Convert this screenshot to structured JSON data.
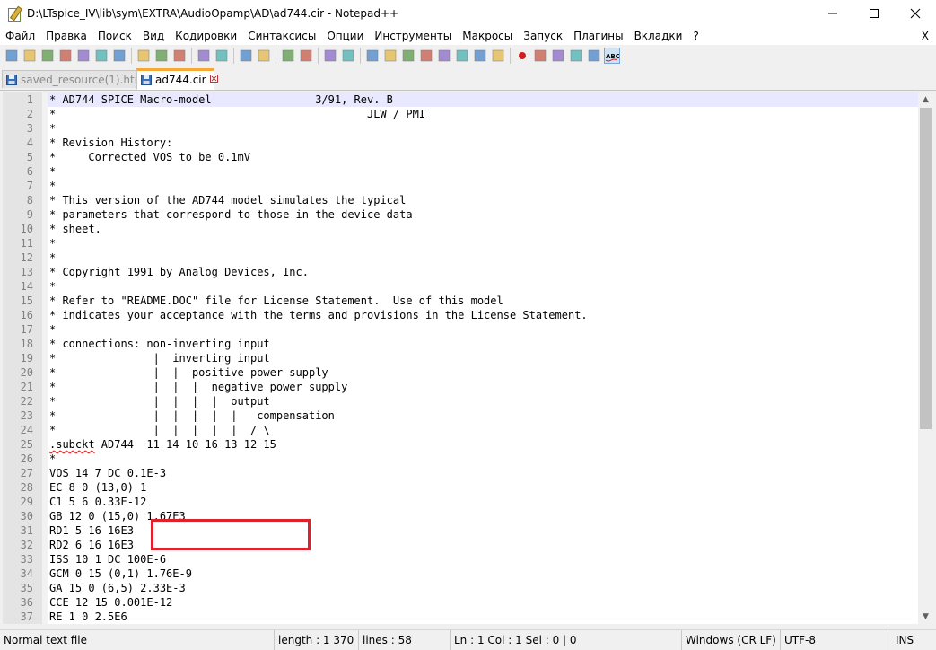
{
  "window": {
    "title": "D:\\LTspice_IV\\lib\\sym\\EXTRA\\AudioOpamp\\AD\\ad744.cir - Notepad++",
    "minimize_glyph": "—",
    "close_glyph": "✕",
    "icon": "notepad-plus-plus-icon"
  },
  "menu": {
    "items": [
      "Файл",
      "Правка",
      "Поиск",
      "Вид",
      "Кодировки",
      "Синтаксисы",
      "Опции",
      "Инструменты",
      "Макросы",
      "Запуск",
      "Плагины",
      "Вкладки",
      "?"
    ],
    "close": "X"
  },
  "toolbar": {
    "buttons": [
      "new-file-icon",
      "open-file-icon",
      "save-icon",
      "save-all-icon",
      "close-icon",
      "close-all-icon",
      "print-icon",
      "cut-icon",
      "copy-icon",
      "paste-icon",
      "undo-icon",
      "redo-icon",
      "find-icon",
      "replace-icon",
      "zoom-in-icon",
      "zoom-out-icon",
      "sync-vertical-icon",
      "sync-horizontal-icon",
      "word-wrap-icon",
      "show-all-chars-icon",
      "indent-guide-icon",
      "user-lang-icon",
      "doc-map-icon",
      "function-list-icon",
      "folder-as-workspace-icon",
      "monitoring-icon",
      "record-macro-icon",
      "stop-macro-icon",
      "play-macro-icon",
      "run-macro-multiple-icon",
      "save-macro-icon",
      "spell-check-icon"
    ],
    "spell_label": "ABC"
  },
  "tabs": [
    {
      "label": "saved_resource(1).html",
      "active": false
    },
    {
      "label": "ad744.cir",
      "active": true
    }
  ],
  "editor": {
    "lines": [
      "* AD744 SPICE Macro-model                3/91, Rev. B",
      "*                                                JLW / PMI",
      "*",
      "* Revision History:",
      "*     Corrected VOS to be 0.1mV",
      "*",
      "*",
      "* This version of the AD744 model simulates the typical",
      "* parameters that correspond to those in the device data",
      "* sheet.",
      "*",
      "*",
      "* Copyright 1991 by Analog Devices, Inc.",
      "*",
      "* Refer to \"README.DOC\" file for License Statement.  Use of this model",
      "* indicates your acceptance with the terms and provisions in the License Statement.",
      "*",
      "* connections: non-inverting input",
      "*               |  inverting input",
      "*               |  |  positive power supply",
      "*               |  |  |  negative power supply",
      "*               |  |  |  |  output",
      "*               |  |  |  |  |   compensation",
      "*               |  |  |  |  |  / \\",
      ".subckt AD744  11 14 10 16 13 12 15",
      "*",
      "VOS 14 7 DC 0.1E-3",
      "EC 8 0 (13,0) 1",
      "C1 5 6 0.33E-12",
      "GB 12 0 (15,0) 1.67E3",
      "RD1 5 16 16E3",
      "RD2 6 16 16E3",
      "ISS 10 1 DC 100E-6",
      "GCM 0 15 (0,1) 1.76E-9",
      "GA 15 0 (6,5) 2.33E-3",
      "CCE 12 15 0.001E-12",
      "RE 1 0 2.5E6"
    ]
  },
  "statusbar": {
    "file_type": "Normal text file",
    "length": "length : 1 370",
    "lines": "lines : 58",
    "position": "Ln : 1    Col : 1    Sel : 0 | 0",
    "eol": "Windows (CR LF)",
    "encoding": "UTF-8",
    "mode": "INS"
  }
}
